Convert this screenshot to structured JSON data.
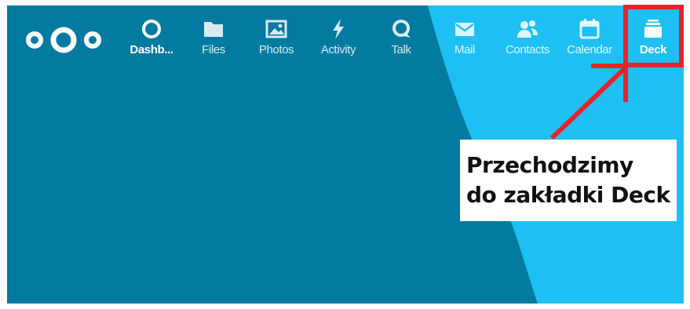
{
  "colors": {
    "dark_background": "#037aa0",
    "light_background": "#1ec0f3",
    "annotation_red": "#e5232a",
    "callout_background": "#ffffff"
  },
  "logo": {
    "icon": "nextcloud-logo-icon"
  },
  "nav": {
    "items": [
      {
        "label": "Dashb...",
        "icon": "dashboard-icon",
        "active": true
      },
      {
        "label": "Files",
        "icon": "folder-icon"
      },
      {
        "label": "Photos",
        "icon": "photo-icon"
      },
      {
        "label": "Activity",
        "icon": "lightning-icon"
      },
      {
        "label": "Talk",
        "icon": "talk-icon"
      },
      {
        "label": "Mail",
        "icon": "mail-icon"
      },
      {
        "label": "Contacts",
        "icon": "contacts-icon"
      },
      {
        "label": "Calendar",
        "icon": "calendar-icon"
      },
      {
        "label": "Deck",
        "icon": "deck-icon",
        "active": true,
        "highlighted": true
      }
    ]
  },
  "annotation": {
    "line1": "Przechodzimy",
    "line2": "do zakładki Deck"
  }
}
